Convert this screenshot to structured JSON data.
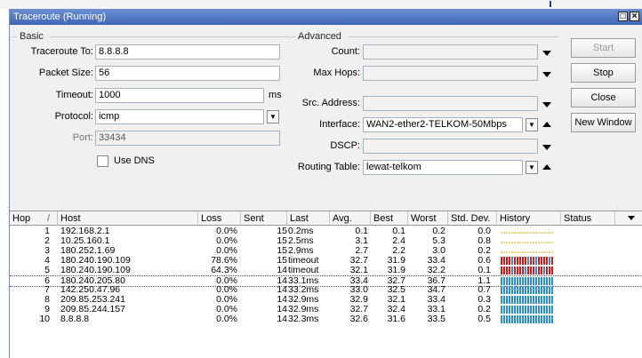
{
  "window": {
    "title": "Traceroute (Running)",
    "maximize_symbol": "□",
    "close_symbol": "×"
  },
  "basic": {
    "group_label": "Basic",
    "traceroute_to_label": "Traceroute To:",
    "traceroute_to_value": "8.8.8.8",
    "packet_size_label": "Packet Size:",
    "packet_size_value": "56",
    "timeout_label": "Timeout:",
    "timeout_value": "1000",
    "timeout_unit": "ms",
    "protocol_label": "Protocol:",
    "protocol_value": "icmp",
    "port_label": "Port:",
    "port_value": "33434",
    "use_dns_label": "Use DNS",
    "use_dns_checked": false
  },
  "advanced": {
    "group_label": "Advanced",
    "count_label": "Count:",
    "count_value": "",
    "max_hops_label": "Max Hops:",
    "max_hops_value": "",
    "src_address_label": "Src. Address:",
    "src_address_value": "",
    "interface_label": "Interface:",
    "interface_value": "WAN2-ether2-TELKOM-50Mbps",
    "dscp_label": "DSCP:",
    "dscp_value": "",
    "routing_table_label": "Routing Table:",
    "routing_table_value": "lewat-telkom"
  },
  "buttons": {
    "start": "Start",
    "stop": "Stop",
    "close": "Close",
    "new_window": "New Window"
  },
  "table": {
    "headers": [
      "Hop",
      "Host",
      "Loss",
      "Sent",
      "Last",
      "Avg.",
      "Best",
      "Worst",
      "Std. Dev.",
      "History",
      "Status"
    ],
    "sort_indicator": "/",
    "rows": [
      {
        "hop": "1",
        "host": "192.168.2.1",
        "loss": "0.0%",
        "sent": "15",
        "last": "0.2ms",
        "avg": "0.1",
        "best": "0.1",
        "worst": "0.2",
        "stddev": "0.0",
        "history": "dashed"
      },
      {
        "hop": "2",
        "host": "10.25.160.1",
        "loss": "0.0%",
        "sent": "15",
        "last": "2.5ms",
        "avg": "3.1",
        "best": "2.4",
        "worst": "5.3",
        "stddev": "0.8",
        "history": "dashed"
      },
      {
        "hop": "3",
        "host": "180.252.1.69",
        "loss": "0.0%",
        "sent": "15",
        "last": "2.9ms",
        "avg": "2.7",
        "best": "2.2",
        "worst": "3.0",
        "stddev": "0.2",
        "history": "dashed"
      },
      {
        "hop": "4",
        "host": "180.240.190.109",
        "loss": "78.6%",
        "sent": "15",
        "last": "timeout",
        "avg": "32.7",
        "best": "31.9",
        "worst": "33.4",
        "stddev": "0.6",
        "history": "lossy"
      },
      {
        "hop": "5",
        "host": "180.240.190.109",
        "loss": "64.3%",
        "sent": "14",
        "last": "timeout",
        "avg": "32.1",
        "best": "31.9",
        "worst": "32.2",
        "stddev": "0.1",
        "history": "lossy"
      },
      {
        "hop": "6",
        "host": "180.240.205.80",
        "loss": "0.0%",
        "sent": "14",
        "last": "33.1ms",
        "avg": "33.4",
        "best": "32.7",
        "worst": "36.7",
        "stddev": "1.1",
        "history": "good"
      },
      {
        "hop": "7",
        "host": "142.250.47.96",
        "loss": "0.0%",
        "sent": "14",
        "last": "33.2ms",
        "avg": "33.0",
        "best": "32.5",
        "worst": "34.7",
        "stddev": "0.7",
        "history": "good"
      },
      {
        "hop": "8",
        "host": "209.85.253.241",
        "loss": "0.0%",
        "sent": "14",
        "last": "32.9ms",
        "avg": "32.9",
        "best": "32.1",
        "worst": "33.4",
        "stddev": "0.3",
        "history": "good"
      },
      {
        "hop": "9",
        "host": "209.85.244.157",
        "loss": "0.0%",
        "sent": "14",
        "last": "32.9ms",
        "avg": "32.7",
        "best": "32.4",
        "worst": "33.1",
        "stddev": "0.2",
        "history": "good"
      },
      {
        "hop": "10",
        "host": "8.8.8.8",
        "loss": "0.0%",
        "sent": "14",
        "last": "32.3ms",
        "avg": "32.6",
        "best": "31.6",
        "worst": "33.5",
        "stddev": "0.5",
        "history": "good"
      }
    ]
  },
  "colors": {
    "history_good": "#2a8fd8",
    "history_loss": "#e01515",
    "history_dashed": "#e0a800",
    "titlebar": "#3f66b6"
  }
}
